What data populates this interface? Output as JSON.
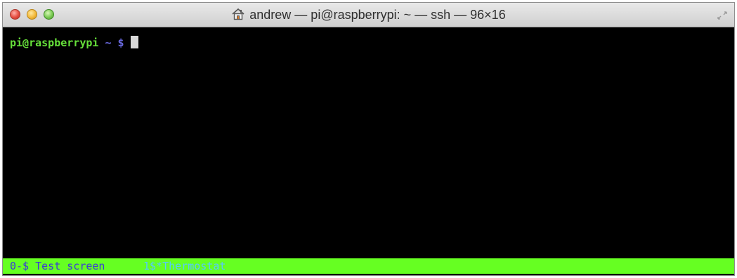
{
  "window": {
    "title": "andrew — pi@raspberrypi: ~ — ssh — 96×16",
    "title_icon": "home-icon",
    "controls": [
      "close",
      "minimize",
      "zoom"
    ]
  },
  "terminal": {
    "prompt_user": "pi@raspberrypi",
    "prompt_dir": "~",
    "prompt_symbol": "$",
    "background": "#000000",
    "prompt_color": "#66e03a",
    "accent_color": "#6a6ae0"
  },
  "statusbar": {
    "active_window": "0-$ Test screen",
    "inactive_window": "1$*Thermostat",
    "background": "#66ff22",
    "active_color": "#3a3ad8",
    "inactive_color": "#57c8ff"
  }
}
